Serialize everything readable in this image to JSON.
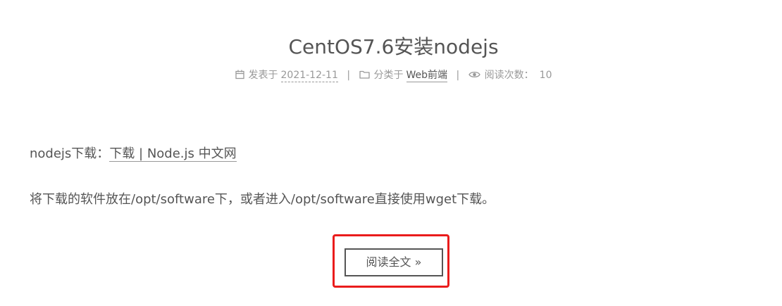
{
  "post": {
    "title": "CentOS7.6安装nodejs",
    "meta": {
      "posted_label": "发表于",
      "date": "2021-12-11",
      "separator": "|",
      "category_label": "分类于",
      "category": "Web前端",
      "views_label": "阅读次数：",
      "views": "10",
      "icons": [
        "calendar-icon",
        "folder-icon",
        "eye-icon"
      ]
    },
    "body": {
      "line1_prefix": "nodejs下载：",
      "line1_link": "下载 | Node.js 中文网",
      "line2": "将下载的软件放在/opt/software下，或者进入/opt/software直接使用wget下载。"
    },
    "read_more": "阅读全文 »"
  },
  "colors": {
    "text": "#555555",
    "meta": "#999999",
    "highlight": "#ea1c1c"
  }
}
